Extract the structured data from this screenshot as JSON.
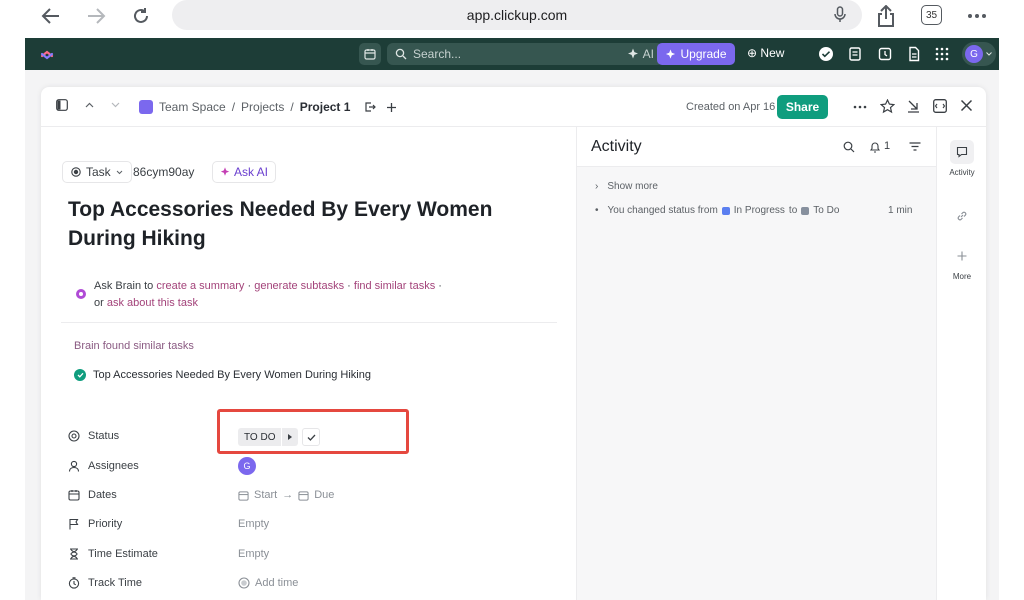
{
  "browser": {
    "url": "app.clickup.com",
    "tab_count": "35"
  },
  "topbar": {
    "search_placeholder": "Search...",
    "ai_label": "AI",
    "upgrade_label": "Upgrade",
    "new_label": "New",
    "avatar_initial": "G"
  },
  "header": {
    "breadcrumbs": [
      "Team Space",
      "Projects",
      "Project 1"
    ],
    "separator": "/",
    "created": "Created on Apr 16",
    "share_label": "Share"
  },
  "task": {
    "type_label": "Task",
    "id": "86cym90ay",
    "ask_ai_label": "Ask AI",
    "title": "Top Accessories Needed By Every Women During Hiking"
  },
  "brain": {
    "prefix": "Ask Brain to",
    "links": [
      "create a summary",
      "generate subtasks",
      "find similar tasks",
      "ask about this task"
    ],
    "sep": "·",
    "or": "or",
    "similar_label": "Brain found similar tasks",
    "similar_task": "Top Accessories Needed By Every Women During Hiking"
  },
  "fields": [
    {
      "label": "Status",
      "icon": "status-icon"
    },
    {
      "label": "Assignees",
      "icon": "person-icon"
    },
    {
      "label": "Dates",
      "icon": "calendar-icon"
    },
    {
      "label": "Priority",
      "icon": "flag-icon"
    },
    {
      "label": "Time Estimate",
      "icon": "hourglass-icon"
    },
    {
      "label": "Track Time",
      "icon": "timer-icon"
    }
  ],
  "values": {
    "status": "TO DO",
    "assignee_initial": "G",
    "start": "Start",
    "arrow": "→",
    "due": "Due",
    "priority": "Empty",
    "time_estimate": "Empty",
    "track_time": "Add time"
  },
  "activity": {
    "title": "Activity",
    "notif_count": "1",
    "show_more": "Show more",
    "entry_prefix": "You changed status from",
    "from_status": "In Progress",
    "to_word": "to",
    "to_status": "To Do",
    "time": "1 min",
    "from_color": "#5b7ff0",
    "to_color": "#87909e"
  },
  "rail": {
    "activity_label": "Activity",
    "more_label": "More"
  },
  "colors": {
    "brand_dark": "#1d3d37",
    "accent": "#7b68ee",
    "share": "#0f9d7e",
    "highlight": "#e5483f"
  }
}
